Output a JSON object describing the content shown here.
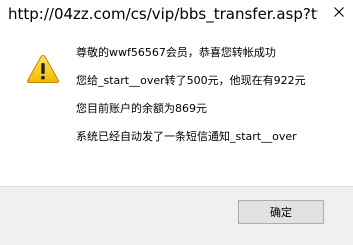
{
  "window": {
    "title": "http://04zz.com/cs/vip/bbs_transfer.asp?ty...",
    "close_icon": "close-icon"
  },
  "dialog": {
    "icon": "warning-icon",
    "messages": [
      "尊敬的wwf56567会员，恭喜您转帐成功",
      "您给_start__over转了500元，他现在有922元",
      "您目前账户的余额为869元",
      "系统已经自动发了一条短信通知_start__over"
    ],
    "ok_label": "确定"
  },
  "colors": {
    "warning_fill": "#f5c400",
    "footer_bg": "#f0f0f0",
    "button_bg": "#e1e1e1",
    "button_border": "#adadad"
  }
}
